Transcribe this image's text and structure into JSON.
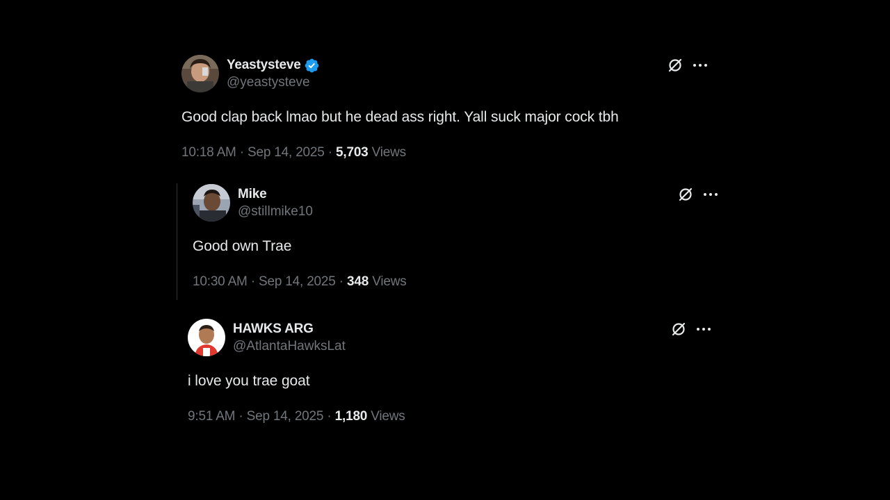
{
  "tweets": [
    {
      "display_name": "Yeastysteve",
      "verified": true,
      "handle": "@yeastysteve",
      "text": "Good clap back lmao but he dead ass right. Yall suck major cock tbh",
      "time": "10:18 AM",
      "date": "Sep 14, 2025",
      "separator": "·",
      "views_count": "5,703",
      "views_label": "Views"
    },
    {
      "display_name": "Mike",
      "verified": false,
      "handle": "@stillmike10",
      "text": "Good own Trae",
      "time": "10:30 AM",
      "date": "Sep 14, 2025",
      "separator": "·",
      "views_count": "348",
      "views_label": "Views"
    },
    {
      "display_name": "HAWKS ARG",
      "verified": false,
      "handle": "@AtlantaHawksLat",
      "text": "i love you trae goat",
      "time": "9:51 AM",
      "date": "Sep 14, 2025",
      "separator": "·",
      "views_count": "1,180",
      "views_label": "Views"
    }
  ],
  "icons": {
    "grok": "grok-icon",
    "more": "more-options-icon",
    "verified": "verified-badge-icon"
  },
  "colors": {
    "background": "#000000",
    "text_primary": "#e7e9ea",
    "text_secondary": "#71767b",
    "verified_blue": "#1d9bf0"
  }
}
